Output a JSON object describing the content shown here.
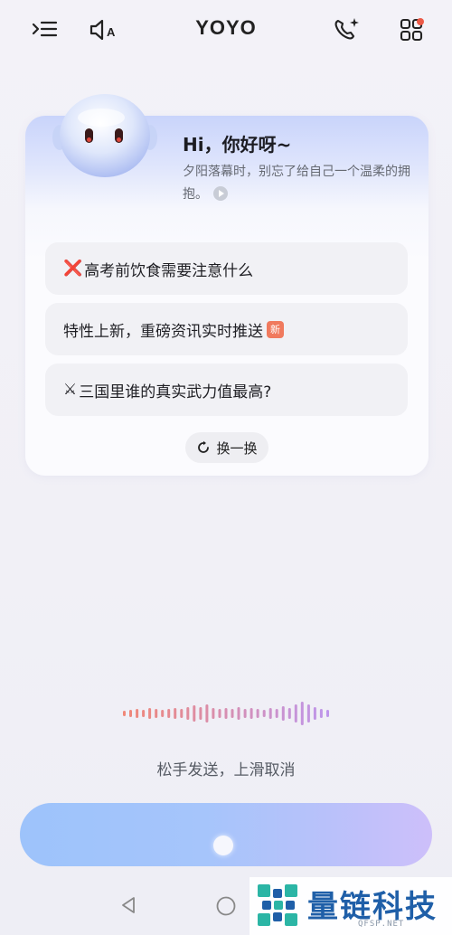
{
  "header": {
    "title": "YOYO",
    "left_icons": [
      "history-menu-icon",
      "speaker-auto-icon"
    ],
    "right_icons": [
      "phone-sparkle-icon",
      "apps-grid-icon"
    ],
    "notification_color": "#ec5a47"
  },
  "greeting": {
    "title": "Hi，你好呀~",
    "subtitle": "夕阳落幕时，别忘了给自己一个温柔的拥抱。",
    "play_icon": "play-circle-icon"
  },
  "suggestions": [
    {
      "lead": "❌",
      "text": "高考前饮食需要注意什么"
    },
    {
      "lead": "",
      "text": "特性上新，重磅资讯实时推送",
      "badge": "新"
    },
    {
      "lead": "⚔",
      "text": "三国里谁的真实武力值最高?"
    }
  ],
  "refresh_label": "换一换",
  "voice": {
    "hint": "松手发送，上滑取消",
    "gradient_start": "#9dc3fb",
    "gradient_end": "#cdbffa"
  },
  "watermark": {
    "text": "量链科技",
    "sub": "QFSP.NET"
  }
}
